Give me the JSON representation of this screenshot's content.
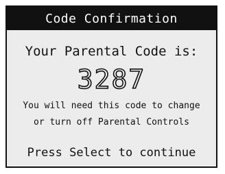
{
  "dialog": {
    "title": "Code Confirmation",
    "heading": "Your Parental Code is:",
    "code": "3287",
    "info_line1": "You will need this code to change",
    "info_line2": "or turn off Parental Controls",
    "prompt": "Press Select to continue"
  },
  "colors": {
    "titlebar_bg": "#111111",
    "titlebar_text": "#ffffff",
    "dialog_bg": "#ececec",
    "text": "#111111"
  }
}
